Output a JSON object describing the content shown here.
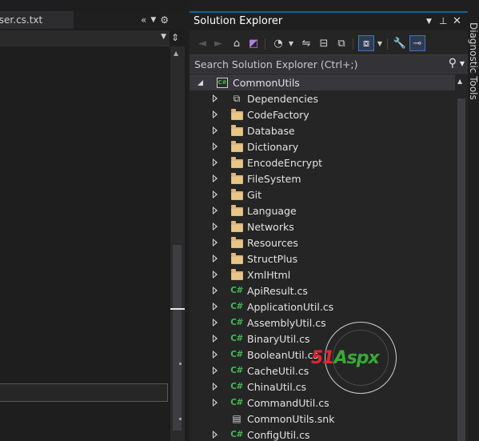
{
  "left_pane": {
    "tab_label": "User.cs.txt",
    "tab_overflow_icon": "chevron-double-left-icon",
    "tab_dropdown_icon": "dropdown-arrow-icon",
    "tab_settings_icon": "gear-icon"
  },
  "solution_explorer": {
    "title": "Solution Explorer",
    "controls": [
      "dropdown-arrow-icon",
      "pin-icon",
      "close-icon"
    ],
    "toolbar_icons": [
      "back-icon",
      "forward-icon",
      "home-icon",
      "switch-views-icon",
      "pending-changes-icon",
      "sync-icon",
      "collapse-all-icon",
      "show-all-files-icon",
      "preview-icon",
      "properties-icon",
      "filter-icon"
    ],
    "search_placeholder": "Search Solution Explorer (Ctrl+;)",
    "project": {
      "name": "CommonUtils",
      "icon": "csharp-project-icon"
    },
    "items": [
      {
        "label": "Dependencies",
        "icon": "dependencies-icon",
        "expandable": true
      },
      {
        "label": "CodeFactory",
        "icon": "folder-icon",
        "expandable": true
      },
      {
        "label": "Database",
        "icon": "folder-icon",
        "expandable": true
      },
      {
        "label": "Dictionary",
        "icon": "folder-icon",
        "expandable": true
      },
      {
        "label": "EncodeEncrypt",
        "icon": "folder-icon",
        "expandable": true
      },
      {
        "label": "FileSystem",
        "icon": "folder-icon",
        "expandable": true
      },
      {
        "label": "Git",
        "icon": "folder-icon",
        "expandable": true
      },
      {
        "label": "Language",
        "icon": "folder-icon",
        "expandable": true
      },
      {
        "label": "Networks",
        "icon": "folder-icon",
        "expandable": true
      },
      {
        "label": "Resources",
        "icon": "folder-icon",
        "expandable": true
      },
      {
        "label": "StructPlus",
        "icon": "folder-icon",
        "expandable": true
      },
      {
        "label": "XmlHtml",
        "icon": "folder-icon",
        "expandable": true
      },
      {
        "label": "ApiResult.cs",
        "icon": "csharp-file-icon",
        "expandable": true
      },
      {
        "label": "ApplicationUtil.cs",
        "icon": "csharp-file-icon",
        "expandable": true
      },
      {
        "label": "AssemblyUtil.cs",
        "icon": "csharp-file-icon",
        "expandable": true
      },
      {
        "label": "BinaryUtil.cs",
        "icon": "csharp-file-icon",
        "expandable": true
      },
      {
        "label": "BooleanUtil.cs",
        "icon": "csharp-file-icon",
        "expandable": true
      },
      {
        "label": "CacheUtil.cs",
        "icon": "csharp-file-icon",
        "expandable": true
      },
      {
        "label": "ChinaUtil.cs",
        "icon": "csharp-file-icon",
        "expandable": true
      },
      {
        "label": "CommandUtil.cs",
        "icon": "csharp-file-icon",
        "expandable": true
      },
      {
        "label": "CommonUtils.snk",
        "icon": "key-file-icon",
        "expandable": false
      },
      {
        "label": "ConfigUtil.cs",
        "icon": "csharp-file-icon",
        "expandable": true
      }
    ]
  },
  "right_strip": {
    "label": "Diagnostic Tools"
  },
  "watermark": {
    "logo_num": "51",
    "logo_text": "Aspx",
    "icon": "watermark-seal-icon"
  },
  "colors": {
    "accent": "#0e639c",
    "folder": "#dcb67a",
    "csharp": "#3fb950",
    "background": "#252526"
  }
}
